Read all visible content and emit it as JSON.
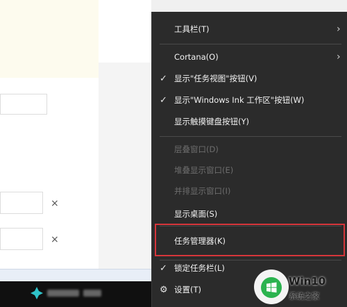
{
  "context_menu": {
    "items": [
      {
        "label": "工具栏(T)",
        "enabled": true,
        "checked": false,
        "submenu": true
      },
      {
        "label": "Cortana(O)",
        "enabled": true,
        "checked": false,
        "submenu": true
      },
      {
        "label": "显示\"任务视图\"按钮(V)",
        "enabled": true,
        "checked": true,
        "submenu": false
      },
      {
        "label": "显示\"Windows Ink 工作区\"按钮(W)",
        "enabled": true,
        "checked": true,
        "submenu": false
      },
      {
        "label": "显示触摸键盘按钮(Y)",
        "enabled": true,
        "checked": false,
        "submenu": false
      },
      {
        "label": "层叠窗口(D)",
        "enabled": false,
        "checked": false,
        "submenu": false
      },
      {
        "label": "堆叠显示窗口(E)",
        "enabled": false,
        "checked": false,
        "submenu": false
      },
      {
        "label": "并排显示窗口(I)",
        "enabled": false,
        "checked": false,
        "submenu": false
      },
      {
        "label": "显示桌面(S)",
        "enabled": true,
        "checked": false,
        "submenu": false
      },
      {
        "label": "任务管理器(K)",
        "enabled": true,
        "checked": false,
        "submenu": false,
        "highlighted": true
      },
      {
        "label": "锁定任务栏(L)",
        "enabled": true,
        "checked": true,
        "submenu": false
      },
      {
        "label": "设置(T)",
        "enabled": true,
        "checked": false,
        "submenu": false,
        "icon": "gear-icon"
      }
    ],
    "check_glyph": "✓",
    "arrow_glyph": "›",
    "gear_glyph": "⚙",
    "highlight_color": "#d6363b"
  },
  "background": {
    "clear_glyph": "×"
  },
  "watermark": {
    "title": "Win10",
    "subtitle": "系统之家"
  }
}
